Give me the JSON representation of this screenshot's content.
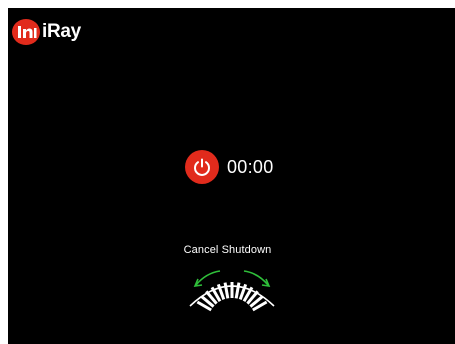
{
  "brand": {
    "logo_text": "iRay",
    "logo_mark_text": "Infi",
    "accent_color": "#e12b1c"
  },
  "shutdown": {
    "icon": "power-icon",
    "countdown": "00:00",
    "cancel_label": "Cancel Shutdown",
    "wheel_icon": "scroll-wheel-icon",
    "arrow_color": "#2fbf3a"
  }
}
